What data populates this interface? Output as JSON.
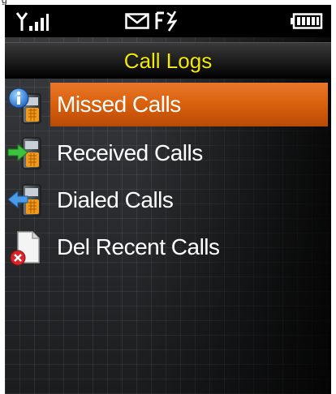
{
  "top_caption": "g",
  "status_bar": {
    "signal_icon": "signal-icon",
    "message_icon": "envelope-icon",
    "network_icon": "network-icon",
    "battery_icon": "battery-icon"
  },
  "title": "Call Logs",
  "menu": {
    "items": [
      {
        "label": "Missed Calls",
        "icon": "missed-calls-icon",
        "selected": true
      },
      {
        "label": "Received Calls",
        "icon": "received-calls-icon",
        "selected": false
      },
      {
        "label": "Dialed Calls",
        "icon": "dialed-calls-icon",
        "selected": false
      },
      {
        "label": "Del Recent Calls",
        "icon": "delete-calls-icon",
        "selected": false
      }
    ]
  },
  "colors": {
    "title": "#f2e80a",
    "selection": "#d9600c",
    "status_bar": "#000000"
  }
}
